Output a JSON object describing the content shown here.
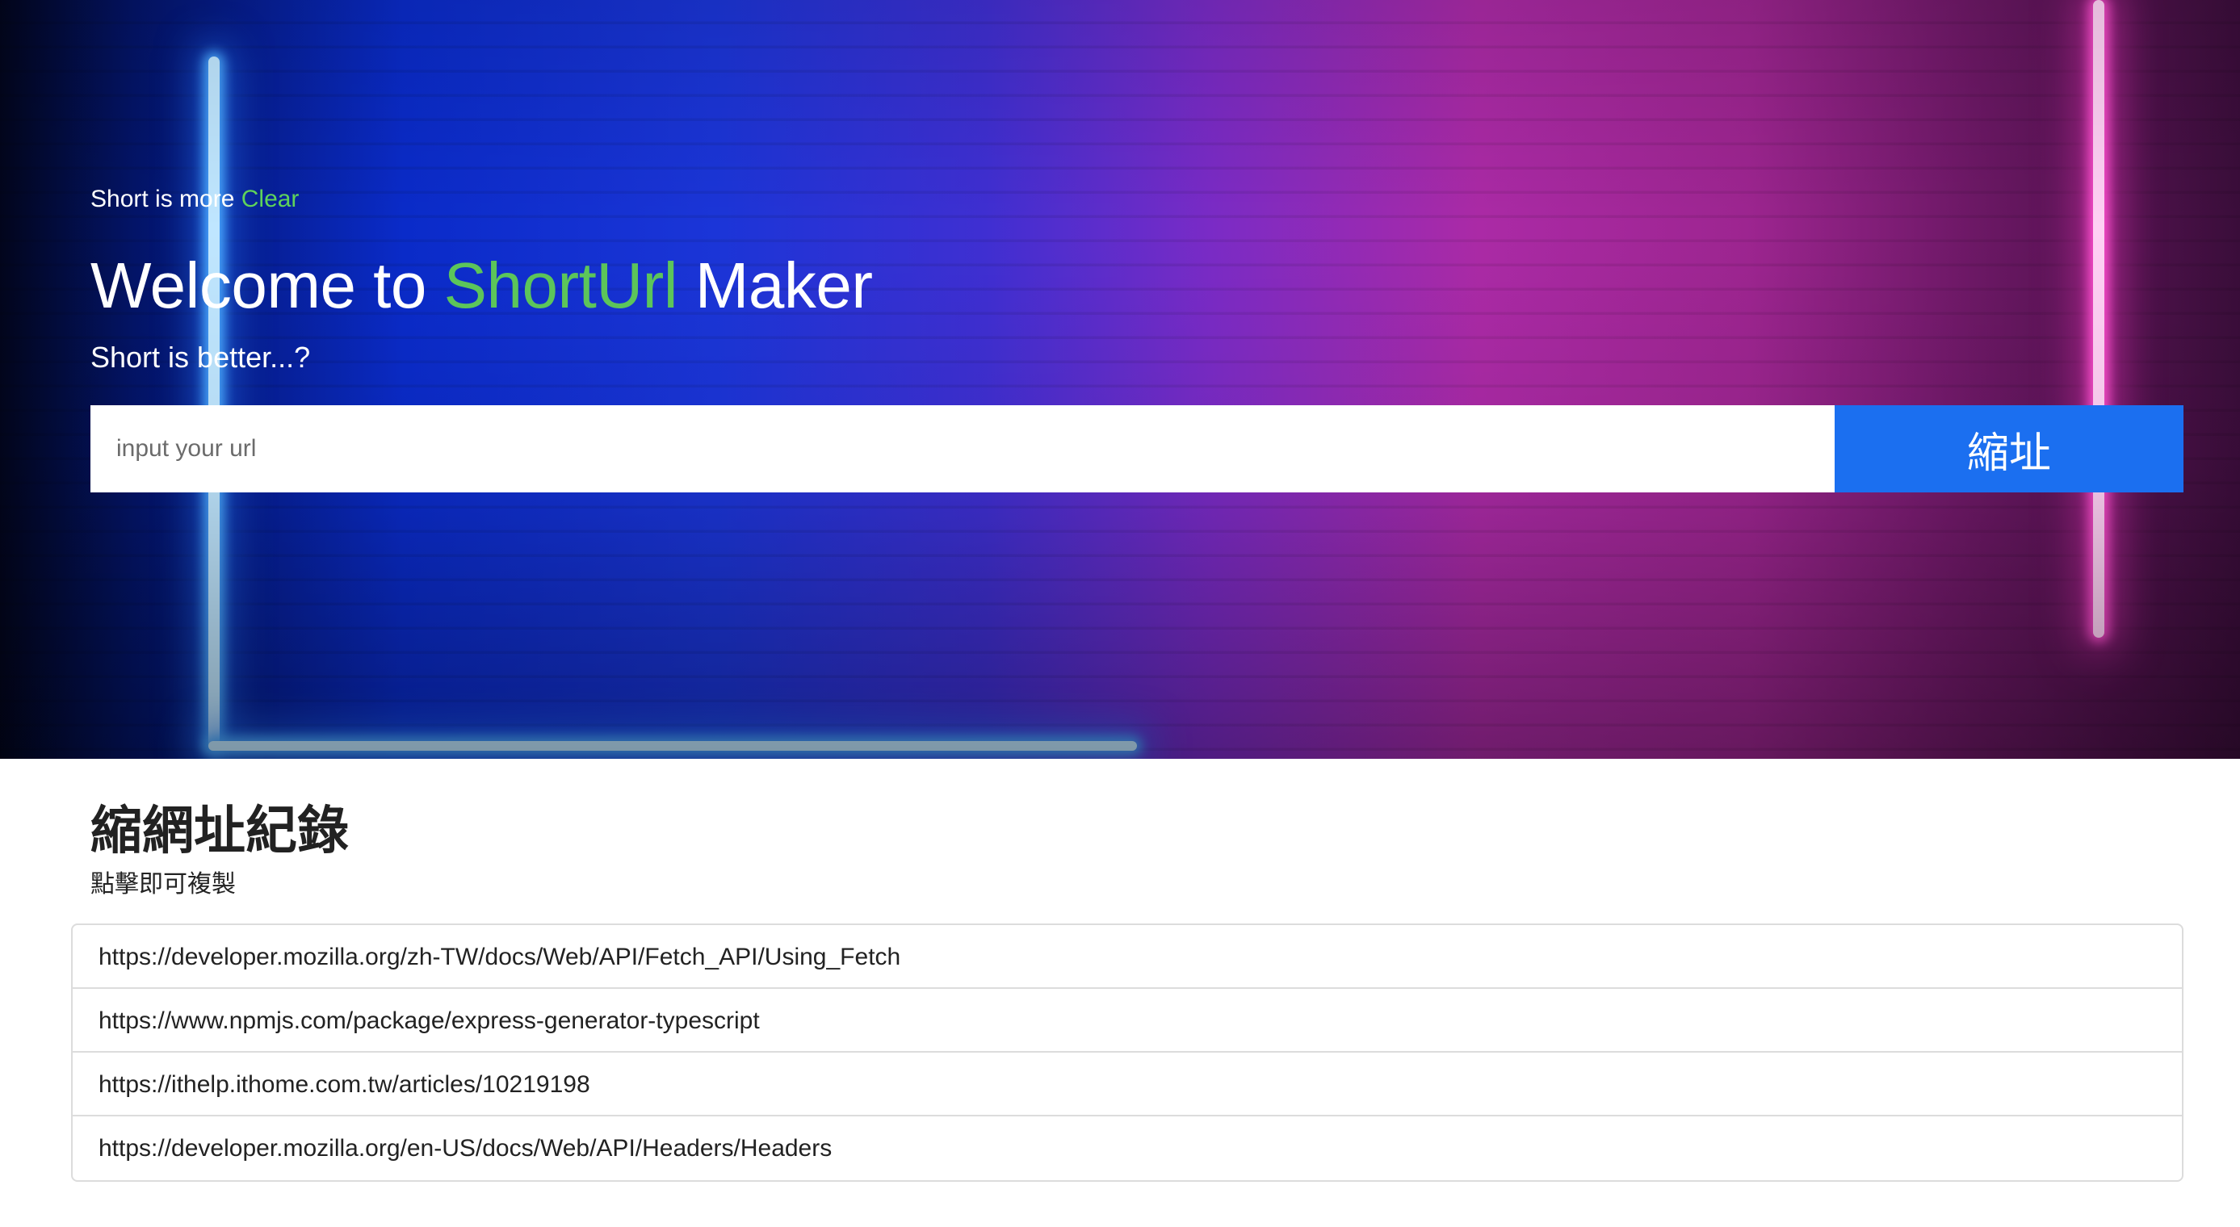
{
  "hero": {
    "eyebrow_text": "Short is more",
    "clear_label": "Clear",
    "title_prefix": "Welcome to",
    "title_brand": "ShortUrl",
    "title_suffix": "Maker",
    "subtitle": "Short is better...?",
    "input_placeholder": "input your url",
    "input_value": "",
    "submit_label": "縮址"
  },
  "history": {
    "title": "縮網址紀錄",
    "hint": "點擊即可複製",
    "items": [
      "https://developer.mozilla.org/zh-TW/docs/Web/API/Fetch_API/Using_Fetch",
      "https://www.npmjs.com/package/express-generator-typescript",
      "https://ithelp.ithome.com.tw/articles/10219198",
      "https://developer.mozilla.org/en-US/docs/Web/API/Headers/Headers"
    ]
  },
  "colors": {
    "brand_green": "#5cc55a",
    "button_blue": "#1b6ff0",
    "list_border": "#dcdcdc"
  }
}
